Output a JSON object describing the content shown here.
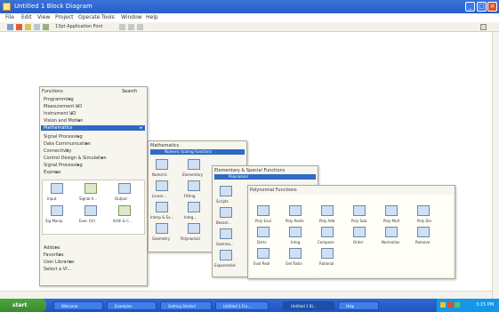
{
  "window": {
    "title": "Untitled 1 Block Diagram",
    "min": "_",
    "max": "□",
    "close": "×"
  },
  "menu": [
    "File",
    "Edit",
    "View",
    "Project",
    "Operate",
    "Tools",
    "Window",
    "Help"
  ],
  "toolbar": {
    "font": "13pt Application Font"
  },
  "functions_palette": {
    "title": "Functions",
    "search": "Search",
    "items": [
      {
        "label": "Programming",
        "arrow": "▸"
      },
      {
        "label": "Measurement I/O",
        "arrow": "▸"
      },
      {
        "label": "Instrument I/O",
        "arrow": "▸"
      },
      {
        "label": "Vision and Motion",
        "arrow": "▸"
      },
      {
        "label": "Mathematics",
        "arrow": "▸",
        "selected": true
      },
      {
        "label": "Signal Processing",
        "arrow": "▸"
      },
      {
        "label": "Data Communication",
        "arrow": "▸"
      },
      {
        "label": "Connectivity",
        "arrow": "▸"
      },
      {
        "label": "Control Design & Simulation",
        "arrow": "▸"
      },
      {
        "label": "Signal Processing",
        "arrow": "▸"
      },
      {
        "label": "Express",
        "arrow": "▸"
      }
    ],
    "icons": [
      {
        "label": "Input",
        "color": "blue"
      },
      {
        "label": "Signal A...",
        "color": "green"
      },
      {
        "label": "Output",
        "color": "blue"
      },
      {
        "label": "Sig Manip",
        "color": "blue"
      },
      {
        "label": "Exec Ctrl",
        "color": "blue"
      },
      {
        "label": "Arith & C...",
        "color": "green"
      }
    ],
    "footer": [
      {
        "label": "Addons",
        "arrow": "▸"
      },
      {
        "label": "Favorites",
        "arrow": "▸"
      },
      {
        "label": "User Libraries",
        "arrow": "▸"
      },
      {
        "label": "Select a VI...",
        "arrow": ""
      }
    ]
  },
  "mathematics_palette": {
    "title": "Mathematics",
    "subtitle": "Numeric Scaling Functions",
    "icons": [
      {
        "label": "Numeric",
        "color": "blue"
      },
      {
        "label": "Elementary",
        "color": "blue"
      },
      {
        "label": "Linear...",
        "color": "blue"
      },
      {
        "label": "Fitting",
        "color": "blue"
      },
      {
        "label": "Interp & Ex...",
        "color": "blue"
      },
      {
        "label": "Integ...",
        "color": "blue"
      },
      {
        "label": "Geometry",
        "color": "blue"
      },
      {
        "label": "Polynomial",
        "color": "blue"
      }
    ]
  },
  "elementary_palette": {
    "title": "Elementary & Special Functions",
    "selected": "Polynomial",
    "icons": [
      {
        "label": "Scripts",
        "color": "blue"
      },
      {
        "label": "Bessel...",
        "color": "blue"
      },
      {
        "label": "Gamma...",
        "color": "blue"
      },
      {
        "label": "Exponential",
        "color": "blue"
      }
    ]
  },
  "polynomial_palette": {
    "title": "Polynomial Functions",
    "icons": [
      {
        "label": "Poly Eval",
        "color": "blue"
      },
      {
        "label": "Poly Roots",
        "color": "blue"
      },
      {
        "label": "Poly Add",
        "color": "blue"
      },
      {
        "label": "Poly Sub",
        "color": "blue"
      },
      {
        "label": "Poly Mult",
        "color": "blue"
      },
      {
        "label": "Poly Div",
        "color": "blue"
      },
      {
        "label": "Deriv",
        "color": "blue"
      },
      {
        "label": "Integ",
        "color": "blue"
      },
      {
        "label": "Compose",
        "color": "blue"
      },
      {
        "label": "Order",
        "color": "blue"
      },
      {
        "label": "Normalize",
        "color": "blue"
      },
      {
        "label": "Remove",
        "color": "blue"
      },
      {
        "label": "Eval Real",
        "color": "blue"
      },
      {
        "label": "Get Ratio",
        "color": "blue"
      },
      {
        "label": "Rational",
        "color": "blue"
      }
    ]
  },
  "taskbar": {
    "start": "start",
    "tasks": [
      {
        "label": "Welcome",
        "active": false
      },
      {
        "label": "Examples",
        "active": false
      },
      {
        "label": "Getting Started",
        "active": false
      },
      {
        "label": "Untitled 1 Fro...",
        "active": false
      },
      {
        "label": "Untitled 1 Bl...",
        "active": true
      },
      {
        "label": "Help",
        "active": false
      }
    ],
    "clock": "3:15 PM"
  }
}
